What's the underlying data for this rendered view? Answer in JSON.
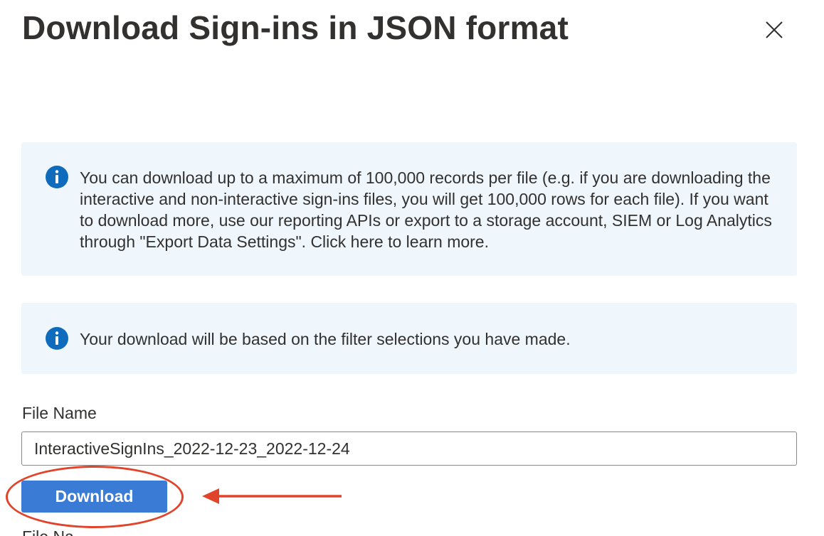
{
  "dialog": {
    "title": "Download Sign-ins in JSON format",
    "close_icon": "close-icon"
  },
  "info_boxes": [
    {
      "icon": "info-icon",
      "text": "You can download up to a maximum of 100,000 records per file (e.g. if you are downloading the interactive and non-interactive sign-ins files, you will get 100,000 rows for each file).  If you want to download more, use our reporting APIs or export to a storage account, SIEM or Log Analytics through \"Export Data Settings\". Click here to learn more."
    },
    {
      "icon": "info-icon",
      "text": "Your download will be based on the filter selections you have made."
    }
  ],
  "file_name": {
    "label": "File Name",
    "value": "InteractiveSignIns_2022-12-23_2022-12-24"
  },
  "download_button": {
    "label": "Download"
  },
  "next_label_partial": "File Na",
  "annotation": {
    "color": "#e0442a",
    "shapes": [
      "callout-ellipse",
      "callout-arrow"
    ]
  },
  "colors": {
    "accent": "#3a7bd5",
    "info_background": "#eff6fc",
    "info_icon": "#0f6cbd"
  }
}
